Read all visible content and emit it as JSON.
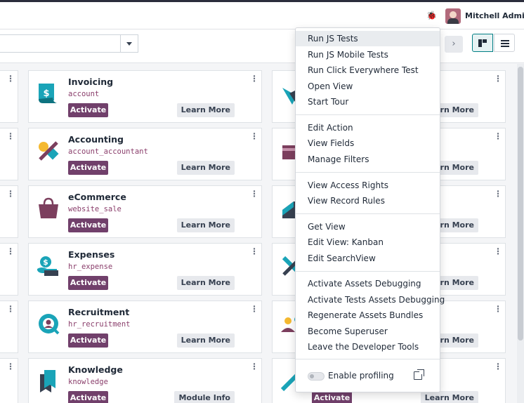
{
  "header": {
    "user_name": "Mitchell Admin",
    "debug_icon": "bug-icon"
  },
  "colors": {
    "activate_button": "#71406b",
    "technical_name": "#8a3e6b",
    "kanban_active_border": "#017e84"
  },
  "cards_middle": [
    {
      "name": "Invoicing",
      "technical": "account",
      "activate": "Activate",
      "secondary": "Learn More",
      "icon": "invoicing-icon"
    },
    {
      "name": "Accounting",
      "technical": "account_accountant",
      "activate": "Activate",
      "secondary": "Learn More",
      "icon": "accounting-icon"
    },
    {
      "name": "eCommerce",
      "technical": "website_sale",
      "activate": "Activate",
      "secondary": "Learn More",
      "icon": "ecommerce-icon"
    },
    {
      "name": "Expenses",
      "technical": "hr_expense",
      "activate": "Activate",
      "secondary": "Learn More",
      "icon": "expenses-icon"
    },
    {
      "name": "Recruitment",
      "technical": "hr_recruitment",
      "activate": "Activate",
      "secondary": "Learn More",
      "icon": "recruitment-icon"
    },
    {
      "name": "Knowledge",
      "technical": "knowledge",
      "activate": "Activate",
      "secondary": "Module Info",
      "icon": "knowledge-icon"
    }
  ],
  "cards_right": [
    {
      "secondary": "arn More"
    },
    {
      "secondary": "arn More"
    },
    {
      "secondary": "arn More"
    },
    {
      "secondary": "arn More"
    },
    {
      "secondary": "arn More"
    },
    {
      "activate": "Activate",
      "secondary": "Learn More"
    }
  ],
  "debug_menu": {
    "groups": [
      [
        "Run JS Tests",
        "Run JS Mobile Tests",
        "Run Click Everywhere Test",
        "Open View",
        "Start Tour"
      ],
      [
        "Edit Action",
        "View Fields",
        "Manage Filters"
      ],
      [
        "View Access Rights",
        "View Record Rules"
      ],
      [
        "Get View",
        "Edit View: Kanban",
        "Edit SearchView"
      ],
      [
        "Activate Assets Debugging",
        "Activate Tests Assets Debugging",
        "Regenerate Assets Bundles",
        "Become Superuser",
        "Leave the Developer Tools"
      ]
    ],
    "profiling_label": "Enable profiling",
    "profiling_enabled": false,
    "active_item": "Run JS Tests"
  }
}
